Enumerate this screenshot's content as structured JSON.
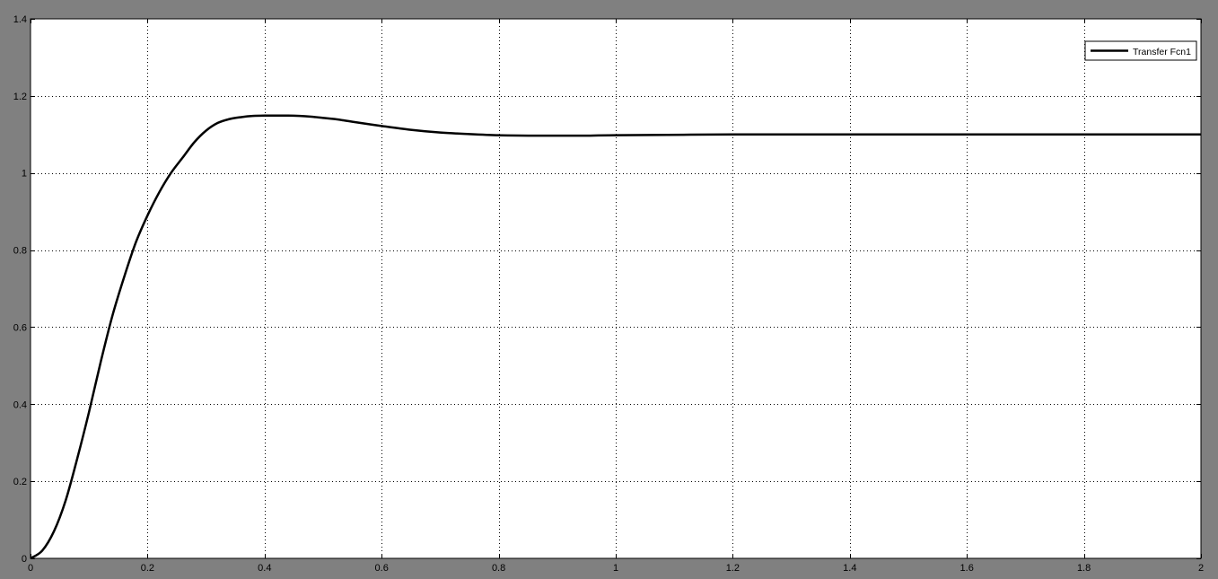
{
  "figure": {
    "background": "#808080",
    "axes_background": "#ffffff",
    "line_color": "#000000"
  },
  "chart_data": {
    "type": "line",
    "title": "",
    "xlabel": "",
    "ylabel": "",
    "xlim": [
      0,
      2
    ],
    "ylim": [
      0,
      1.4
    ],
    "xticks": [
      0,
      0.2,
      0.4,
      0.6,
      0.8,
      1,
      1.2,
      1.4,
      1.6,
      1.8,
      2
    ],
    "yticks": [
      0,
      0.2,
      0.4,
      0.6,
      0.8,
      1,
      1.2,
      1.4
    ],
    "xtick_labels": [
      "0",
      "0.2",
      "0.4",
      "0.6",
      "0.8",
      "1",
      "1.2",
      "1.4",
      "1.6",
      "1.8",
      "2"
    ],
    "ytick_labels": [
      "0",
      "0.2",
      "0.4",
      "0.6",
      "0.8",
      "1",
      "1.2",
      "1.4"
    ],
    "grid": true,
    "legend_position": "top-right",
    "series": [
      {
        "name": "Transfer Fcn1",
        "color": "#000000",
        "x": [
          0,
          0.02,
          0.04,
          0.06,
          0.08,
          0.1,
          0.12,
          0.14,
          0.16,
          0.18,
          0.2,
          0.22,
          0.24,
          0.26,
          0.28,
          0.3,
          0.32,
          0.34,
          0.36,
          0.38,
          0.4,
          0.42,
          0.44,
          0.46,
          0.48,
          0.5,
          0.52,
          0.55,
          0.6,
          0.65,
          0.7,
          0.75,
          0.8,
          0.85,
          0.9,
          0.95,
          1.0,
          1.2,
          1.4,
          1.6,
          1.8,
          2.0
        ],
        "y": [
          0,
          0.02,
          0.07,
          0.15,
          0.26,
          0.38,
          0.51,
          0.63,
          0.73,
          0.82,
          0.89,
          0.95,
          1.0,
          1.04,
          1.08,
          1.11,
          1.13,
          1.14,
          1.145,
          1.148,
          1.149,
          1.149,
          1.149,
          1.148,
          1.146,
          1.143,
          1.14,
          1.133,
          1.122,
          1.112,
          1.105,
          1.101,
          1.098,
          1.097,
          1.097,
          1.097,
          1.098,
          1.1,
          1.1,
          1.1,
          1.1,
          1.1
        ]
      }
    ]
  }
}
